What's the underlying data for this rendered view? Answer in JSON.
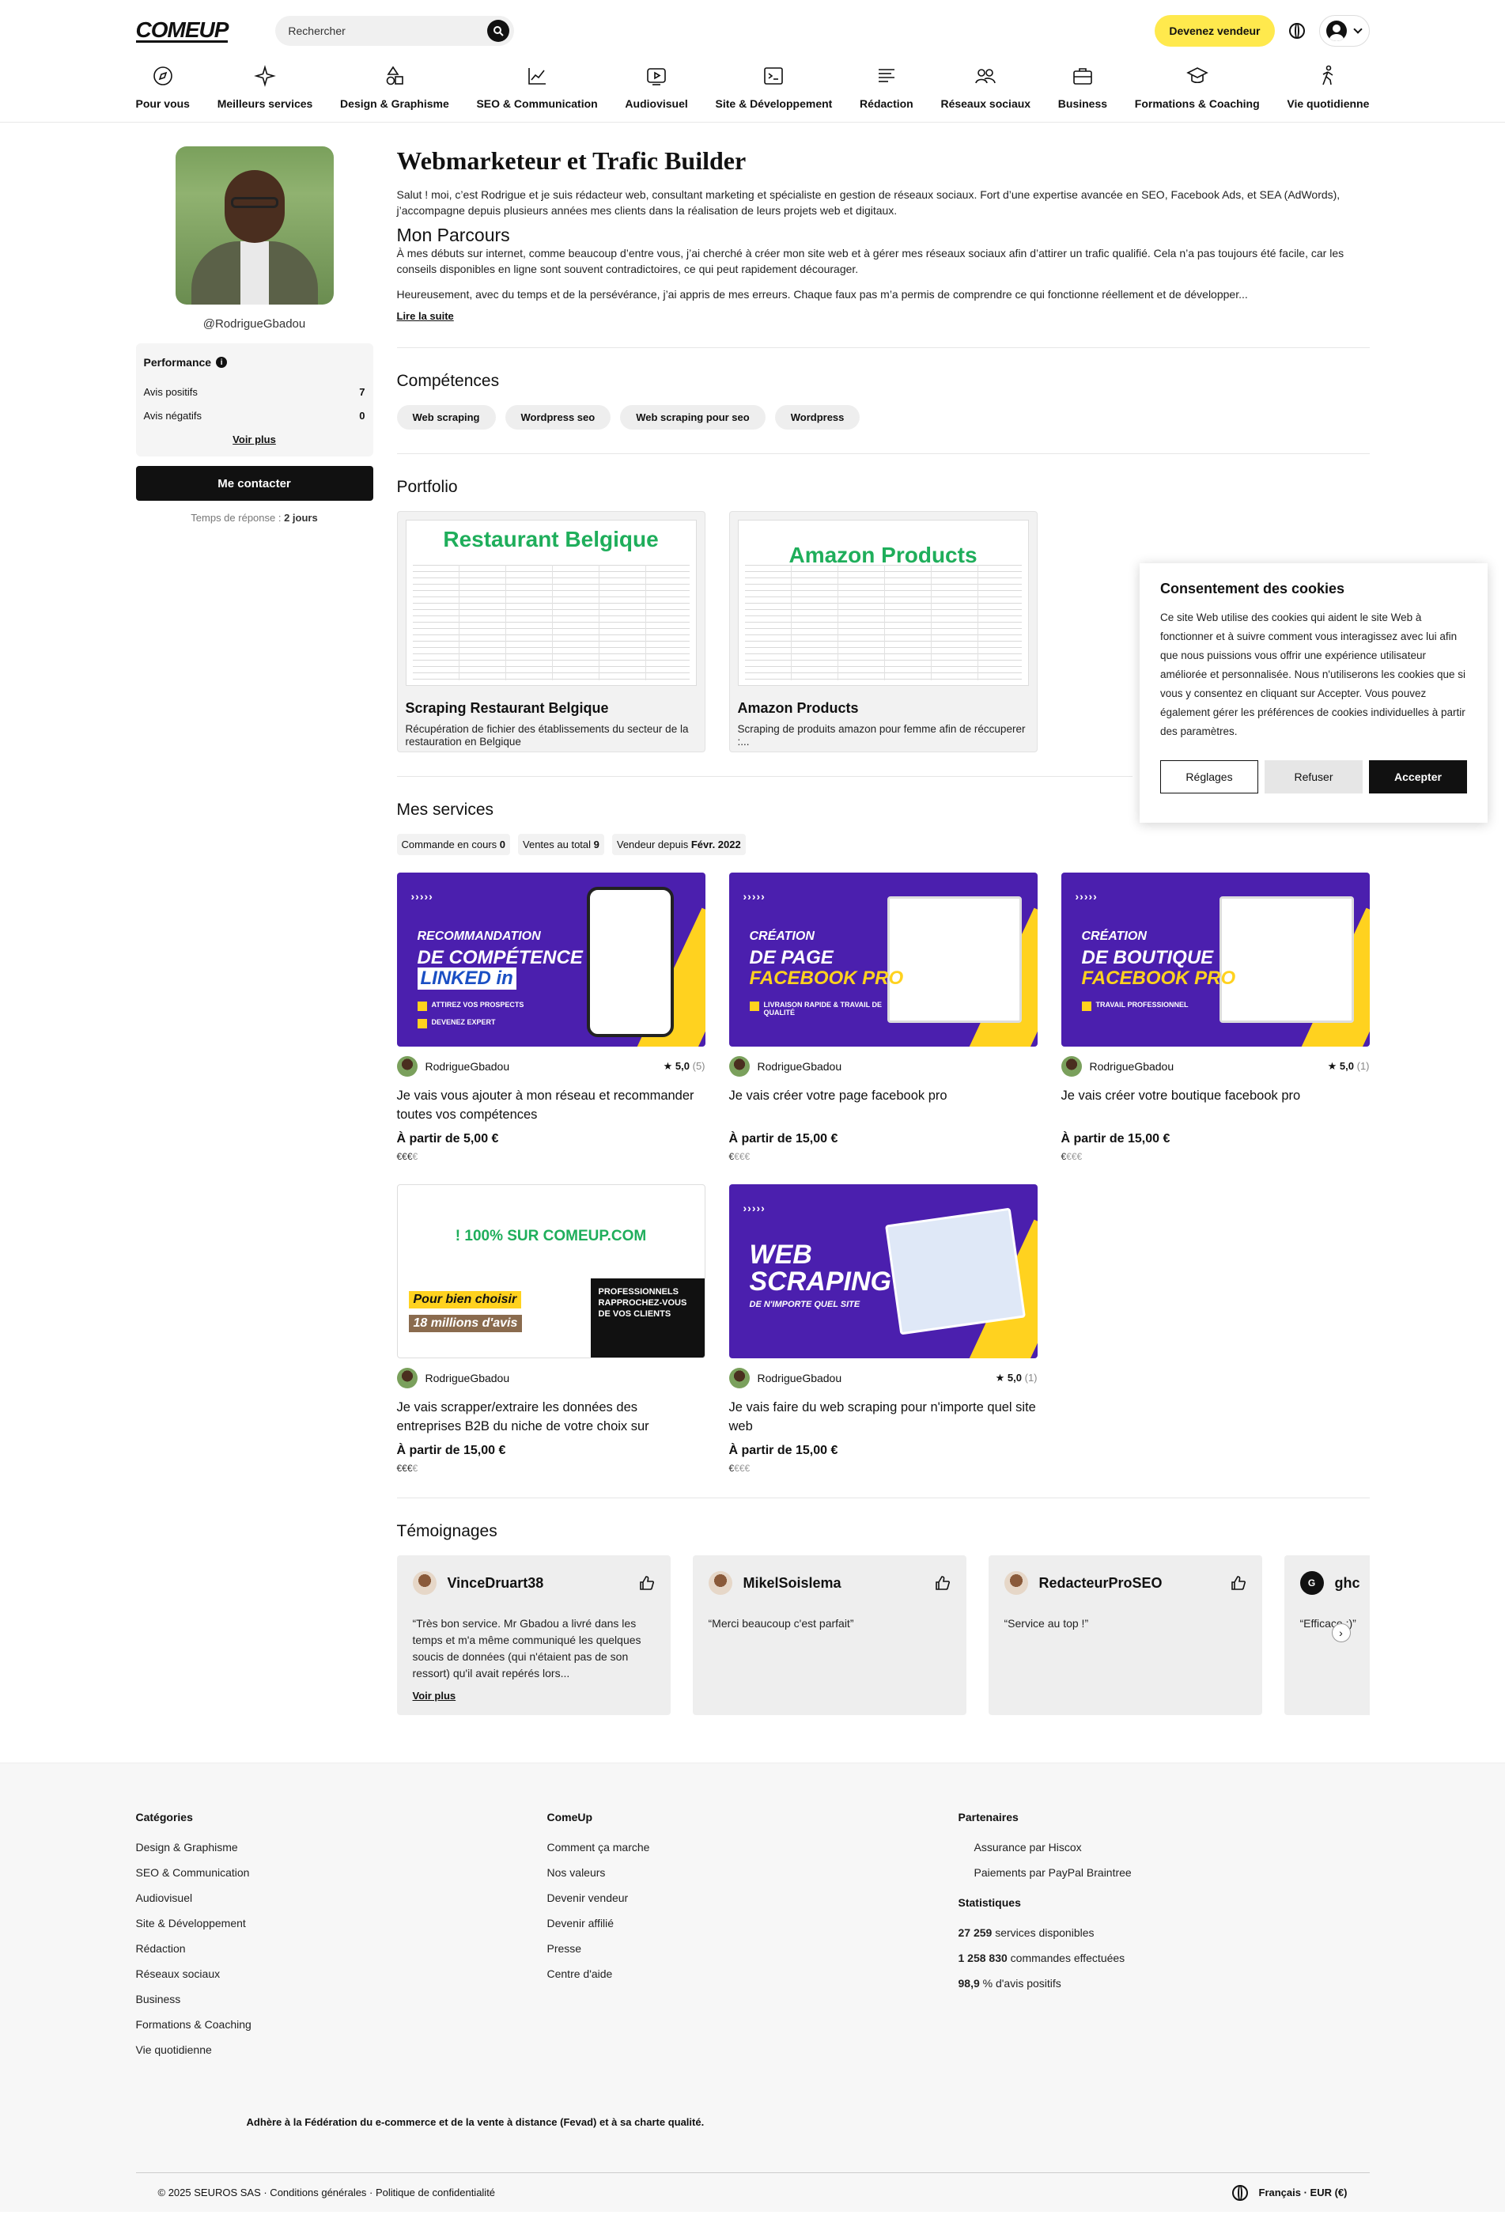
{
  "header": {
    "logo": "COMEUP",
    "search_placeholder": "Rechercher",
    "become_seller": "Devenez vendeur"
  },
  "categories": [
    {
      "label": "Pour vous",
      "icon": "compass-icon"
    },
    {
      "label": "Meilleurs services",
      "icon": "sparkle-icon"
    },
    {
      "label": "Design & Graphisme",
      "icon": "shapes-icon"
    },
    {
      "label": "SEO & Communication",
      "icon": "chart-line-icon"
    },
    {
      "label": "Audiovisuel",
      "icon": "play-icon"
    },
    {
      "label": "Site & Développement",
      "icon": "terminal-icon"
    },
    {
      "label": "Rédaction",
      "icon": "text-lines-icon"
    },
    {
      "label": "Réseaux sociaux",
      "icon": "people-icon"
    },
    {
      "label": "Business",
      "icon": "briefcase-icon"
    },
    {
      "label": "Formations & Coaching",
      "icon": "graduation-icon"
    },
    {
      "label": "Vie quotidienne",
      "icon": "walking-icon"
    }
  ],
  "profile": {
    "username": "@RodrigueGbadou",
    "performance_title": "Performance",
    "positive_label": "Avis positifs",
    "positive_value": "7",
    "negative_label": "Avis négatifs",
    "negative_value": "0",
    "see_more": "Voir plus",
    "contact_button": "Me contacter",
    "response_label": "Temps de réponse :",
    "response_value": "2 jours"
  },
  "about": {
    "title": "Webmarketeur et Trafic Builder",
    "intro": "Salut ! moi, c’est Rodrigue et je suis rédacteur web, consultant marketing et spécialiste en gestion de réseaux sociaux. Fort d’une expertise avancée en SEO, Facebook Ads, et SEA (AdWords), j’accompagne depuis plusieurs années mes clients dans la réalisation de leurs projets web et digitaux.",
    "parcours_title": "Mon Parcours",
    "parcours_p1": "À mes débuts sur internet, comme beaucoup d’entre vous, j’ai cherché à créer mon site web et à gérer mes réseaux sociaux afin d’attirer un trafic qualifié. Cela n’a pas toujours été facile, car les conseils disponibles en ligne sont souvent contradictoires, ce qui peut rapidement décourager.",
    "parcours_p2": "Heureusement, avec du temps et de la persévérance, j’ai appris de mes erreurs. Chaque faux pas m’a permis de comprendre ce qui fonctionne réellement et de développer...",
    "read_more": "Lire la suite"
  },
  "skills": {
    "title": "Compétences",
    "items": [
      "Web scraping",
      "Wordpress seo",
      "Web scraping pour seo",
      "Wordpress"
    ]
  },
  "portfolio": {
    "title": "Portfolio",
    "items": [
      {
        "image_text": "Restaurant Belgique",
        "title": "Scraping Restaurant Belgique",
        "desc": "Récupération de fichier des établissements du secteur de la restauration en Belgique"
      },
      {
        "image_text": "Amazon Products",
        "title": "Amazon Products",
        "desc": "Scraping de produits amazon pour femme afin de réccuperer :..."
      }
    ]
  },
  "services": {
    "title": "Mes services",
    "stats": [
      {
        "label": "Commande en cours",
        "value": "0"
      },
      {
        "label": "Ventes au total",
        "value": "9"
      },
      {
        "label": "Vendeur depuis",
        "value": "Févr. 2022"
      }
    ],
    "items": [
      {
        "seller": "RodrigueGbadou",
        "rating": "5,0",
        "count": "(5)",
        "title": "Je vais vous ajouter à mon réseau et recommander toutes vos compétences",
        "price": "À partir de 5,00 €",
        "euro_strong": "€€€",
        "euro_light": "€",
        "img_lines": [
          "RECOMMANDATION",
          "DE COMPÉTENCE",
          "LINKED in"
        ],
        "img_badges": [
          "ATTIREZ VOS PROSPECTS",
          "DEVENEZ EXPERT"
        ]
      },
      {
        "seller": "RodrigueGbadou",
        "rating": "",
        "count": "",
        "title": "Je vais créer votre page facebook pro",
        "price": "À partir de 15,00 €",
        "euro_strong": "€",
        "euro_light": "€€€",
        "img_lines": [
          "CRÉATION",
          "DE PAGE",
          "FACEBOOK PRO"
        ],
        "img_badges": [
          "LIVRAISON RAPIDE & TRAVAIL DE QUALITÉ"
        ]
      },
      {
        "seller": "RodrigueGbadou",
        "rating": "5,0",
        "count": "(1)",
        "title": "Je vais créer votre boutique facebook pro",
        "price": "À partir de 15,00 €",
        "euro_strong": "€",
        "euro_light": "€€€",
        "img_lines": [
          "CRÉATION",
          "DE BOUTIQUE",
          "FACEBOOK PRO"
        ],
        "img_badges": [
          "TRAVAIL PROFESSIONNEL"
        ]
      },
      {
        "seller": "RodrigueGbadou",
        "rating": "",
        "count": "",
        "title": "Je vais scrapper/extraire les données des entreprises B2B du niche de votre choix sur",
        "price": "À partir de 15,00 €",
        "euro_strong": "€€€",
        "euro_light": "€",
        "img_lines": [
          "! 100% SUR COMEUP.COM",
          "Pour bien choisir",
          "18 millions d'avis"
        ],
        "img_badges": [
          "PROFESSIONNELS RAPPROCHEZ-VOUS DE VOS CLIENTS"
        ]
      },
      {
        "seller": "RodrigueGbadou",
        "rating": "5,0",
        "count": "(1)",
        "title": "Je vais faire du web scraping pour n'importe quel site web",
        "price": "À partir de 15,00 €",
        "euro_strong": "€",
        "euro_light": "€€€",
        "img_lines": [
          "WEB",
          "SCRAPING",
          "DE N'IMPORTE QUEL SITE"
        ],
        "img_badges": []
      }
    ]
  },
  "testimonials": {
    "title": "Témoignages",
    "items": [
      {
        "name": "VinceDruart38",
        "text": "“Très bon service. Mr Gbadou a livré dans les temps et m'a même communiqué les quelques soucis de données (qui n'étaient pas de son ressort) qu'il avait repérés lors...",
        "more": "Voir plus"
      },
      {
        "name": "MikelSoislema",
        "text": "“Merci beaucoup c'est parfait”",
        "more": ""
      },
      {
        "name": "RedacteurProSEO",
        "text": "“Service au top !”",
        "more": ""
      },
      {
        "name": "ghc",
        "avatar_letter": "G",
        "text": "“Efficace :)”",
        "more": ""
      }
    ]
  },
  "cookie": {
    "title": "Consentement des cookies",
    "text": "Ce site Web utilise des cookies qui aident le site Web à fonctionner et à suivre comment vous interagissez avec lui afin que nous puissions vous offrir une expérience utilisateur améliorée et personnalisée. Nous n'utiliserons les cookies que si vous y consentez en cliquant sur Accepter. Vous pouvez également gérer les préférences de cookies individuelles à partir des paramètres.",
    "settings": "Réglages",
    "refuse": "Refuser",
    "accept": "Accepter"
  },
  "footer": {
    "col1_title": "Catégories",
    "col1": [
      "Design & Graphisme",
      "SEO & Communication",
      "Audiovisuel",
      "Site & Développement",
      "Rédaction",
      "Réseaux sociaux",
      "Business",
      "Formations & Coaching",
      "Vie quotidienne"
    ],
    "col2_title": "ComeUp",
    "col2": [
      "Comment ça marche",
      "Nos valeurs",
      "Devenir vendeur",
      "Devenir affilié",
      "Presse",
      "Centre d'aide"
    ],
    "col3_title": "Partenaires",
    "col3": [
      "Assurance par Hiscox",
      "Paiements par PayPal Braintree"
    ],
    "stats_title": "Statistiques",
    "stats": [
      {
        "value": "27 259",
        "label": "services disponibles"
      },
      {
        "value": "1 258 830",
        "label": "commandes effectuées"
      },
      {
        "value": "98,9",
        "label": "% d'avis positifs"
      }
    ],
    "fevad": "Adhère à la Fédération du e-commerce et de la vente à distance (Fevad) et à sa charte qualité.",
    "copyright": "© 2025 SEUROS SAS · Conditions générales · Politique de confidentialité",
    "lang": "Français · EUR (€)"
  },
  "colors": {
    "accent_yellow": "#ffe94d",
    "service_purple": "#4b1fae",
    "portfolio_green": "#1fae5b"
  }
}
